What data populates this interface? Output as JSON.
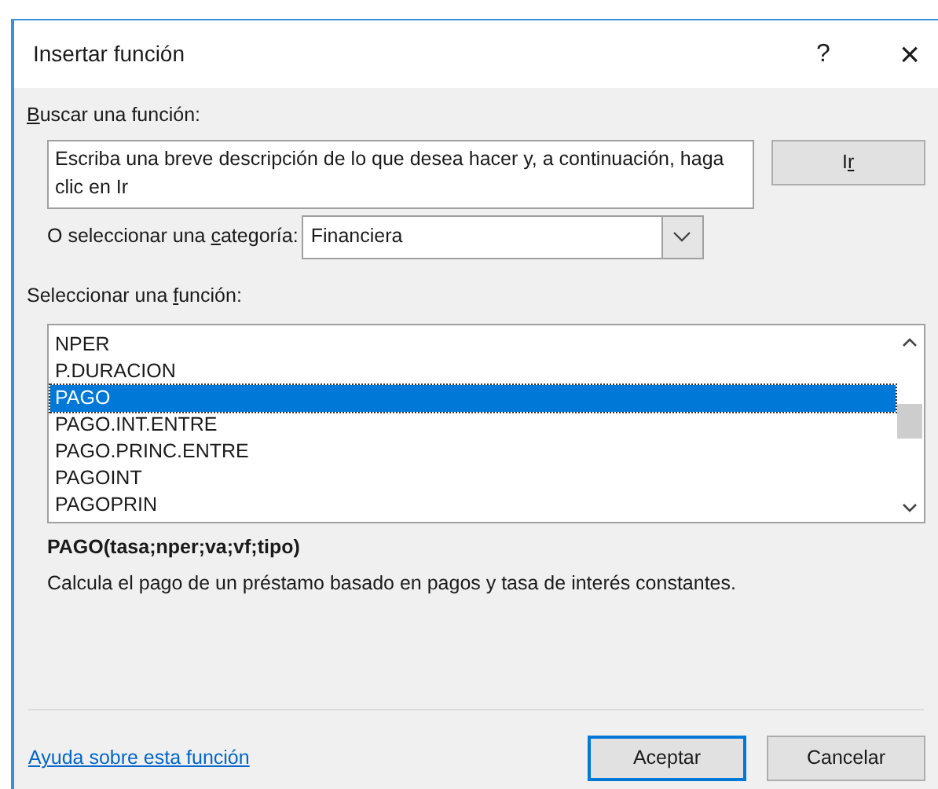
{
  "window": {
    "title": "Insertar función",
    "buttons": [
      "?",
      "×"
    ]
  },
  "search": {
    "label": {
      "key": "B",
      "after": "uscar una función:"
    },
    "placeholder": "Escriba una breve descripción de lo que desea hacer y, a continuación, haga clic en Ir",
    "button": {
      "before": "I",
      "key": "r"
    }
  },
  "category": {
    "label": {
      "before": "O seleccionar una ",
      "key": "c",
      "after": "ategoría:"
    },
    "value": "Financiera"
  },
  "function_list": {
    "label": {
      "before": "Seleccionar una ",
      "key": "f",
      "after": "unción:"
    },
    "items": [
      {
        "name": "NPER",
        "selected": false
      },
      {
        "name": "P.DURACION",
        "selected": false
      },
      {
        "name": "PAGO",
        "selected": true
      },
      {
        "name": "PAGO.INT.ENTRE",
        "selected": false
      },
      {
        "name": "PAGO.PRINC.ENTRE",
        "selected": false
      },
      {
        "name": "PAGOINT",
        "selected": false
      },
      {
        "name": "PAGOPRIN",
        "selected": false
      }
    ]
  },
  "signature": "PAGO(tasa;nper;va;vf;tipo)",
  "description": "Calcula el pago de un préstamo basado en pagos y tasa de interés constantes.",
  "help_link": "Ayuda sobre esta función",
  "buttons": [
    {
      "label": "Aceptar",
      "default": true
    },
    {
      "label": "Cancelar",
      "default": false
    }
  ]
}
